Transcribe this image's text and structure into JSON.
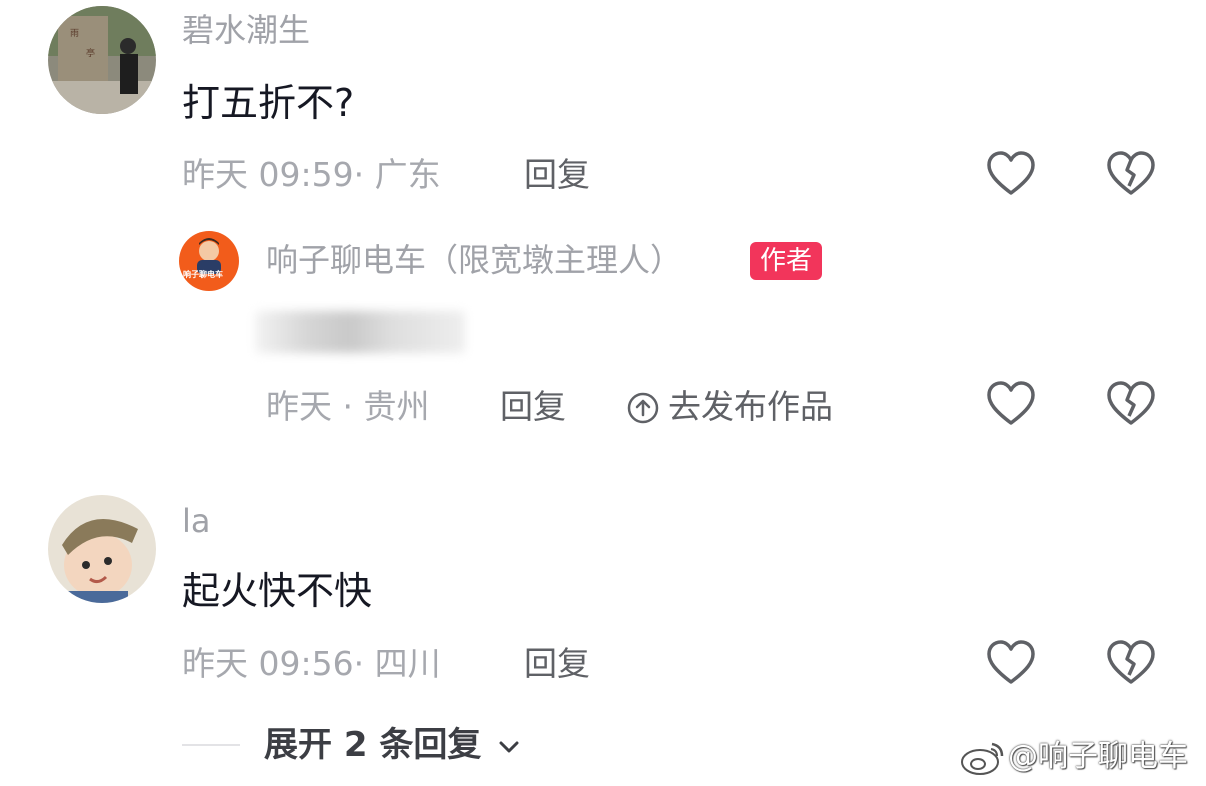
{
  "comments": [
    {
      "username": "碧水潮生",
      "text": "打五折不?",
      "meta": "昨天 09:59· 广东",
      "reply_label": "回复"
    },
    {
      "username": "la",
      "text": "起火快不快",
      "meta": "昨天 09:56· 四川",
      "reply_label": "回复",
      "expand_label": "展开 2 条回复"
    }
  ],
  "author_reply": {
    "username": "响子聊电车（限宽墩主理人）",
    "badge": "作者",
    "avatar_text": "响子聊电车",
    "meta": "昨天 · 贵州",
    "reply_label": "回复",
    "publish_label": "去发布作品"
  },
  "watermark": "@响子聊电车",
  "colors": {
    "badge": "#f2355b",
    "author_avatar_bg": "#f25c1b",
    "muted_text": "#a6a8ae"
  },
  "icons": [
    "heart-outline-icon",
    "broken-heart-icon",
    "upload-circle-icon",
    "chevron-down-icon",
    "weibo-icon"
  ]
}
